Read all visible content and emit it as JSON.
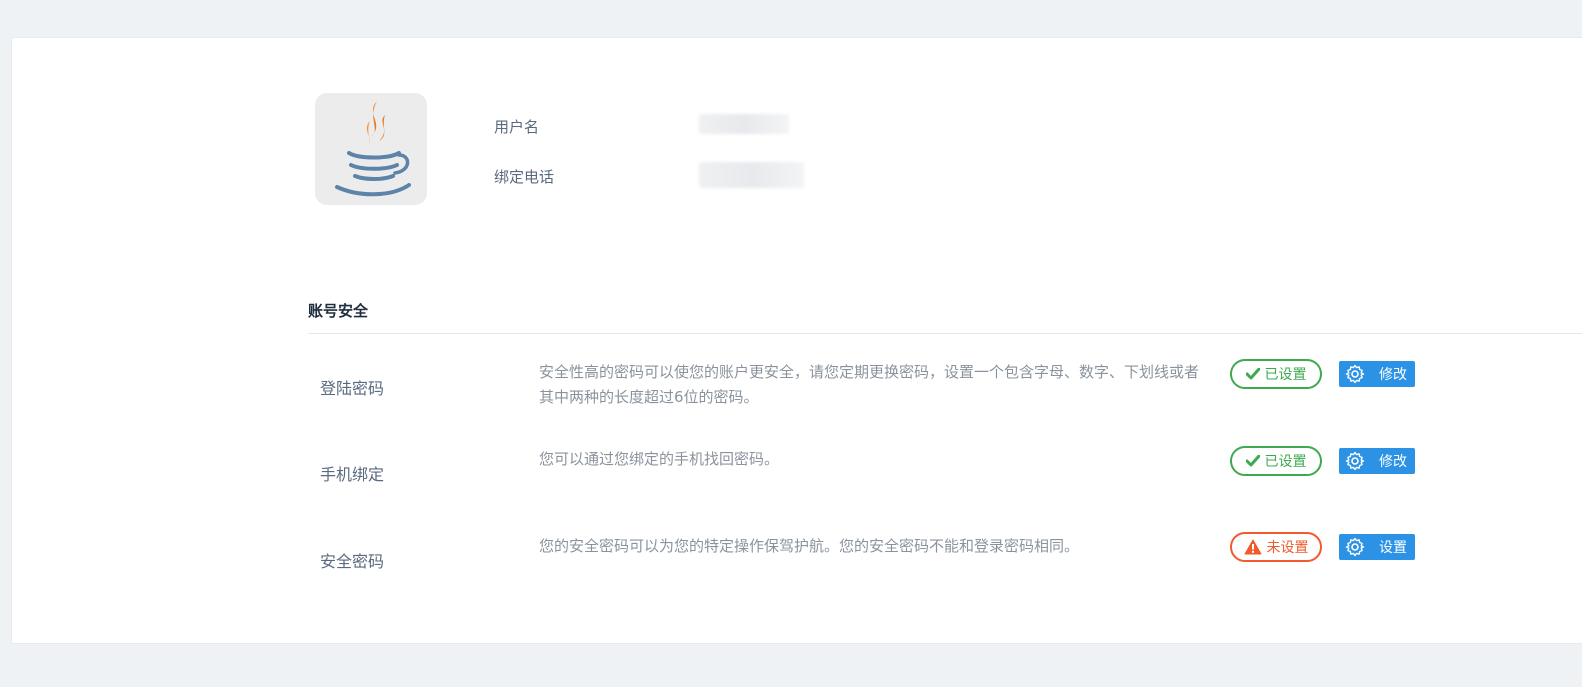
{
  "profile": {
    "avatar_icon": "java-coffee-cup-icon",
    "username_label": "用户名",
    "username_value": "",
    "phone_label": "绑定电话",
    "phone_value": ""
  },
  "security": {
    "title": "账号安全",
    "rows": [
      {
        "label": "登陆密码",
        "desc": "安全性高的密码可以使您的账户更安全，请您定期更换密码，设置一个包含字母、数字、下划线或者其中两种的长度超过6位的密码。",
        "status": "已设置",
        "status_icon": "check-icon",
        "status_color": "#3daa4f",
        "action": "修改",
        "action_icon": "gear-icon"
      },
      {
        "label": "手机绑定",
        "desc": "您可以通过您绑定的手机找回密码。",
        "status": "已设置",
        "status_icon": "check-icon",
        "status_color": "#3daa4f",
        "action": "修改",
        "action_icon": "gear-icon"
      },
      {
        "label": "安全密码",
        "desc": "您的安全密码可以为您的特定操作保驾护航。您的安全密码不能和登录密码相同。",
        "status": "未设置",
        "status_icon": "warning-icon",
        "status_color": "#f15a2b",
        "action": "设置",
        "action_icon": "gear-icon"
      }
    ]
  },
  "colors": {
    "background": "#eef2f5",
    "primary_button": "#2b92e6",
    "success": "#3daa4f",
    "danger": "#f15a2b"
  }
}
